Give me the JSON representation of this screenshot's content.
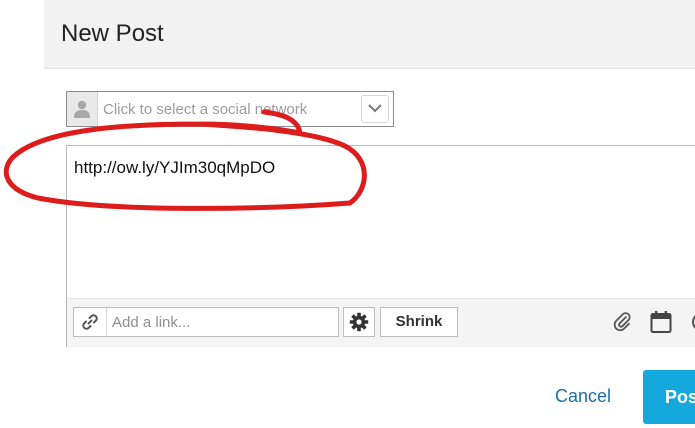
{
  "header": {
    "title": "New Post"
  },
  "network_select": {
    "placeholder": "Click to select a social network"
  },
  "composer": {
    "message": "http://ow.ly/YJIm30qMpDO"
  },
  "toolbar": {
    "link_placeholder": "Add a link...",
    "shrink_label": "Shrink",
    "icons": [
      "link-icon",
      "gear-icon",
      "paperclip-icon",
      "calendar-icon"
    ]
  },
  "actions": {
    "cancel_label": "Cancel",
    "post_label": "Post"
  },
  "colors": {
    "header_bg": "#f2f2f2",
    "post_button": "#15a8dd",
    "cancel_link": "#1c6fa8",
    "annotation": "#dd1c1c"
  }
}
